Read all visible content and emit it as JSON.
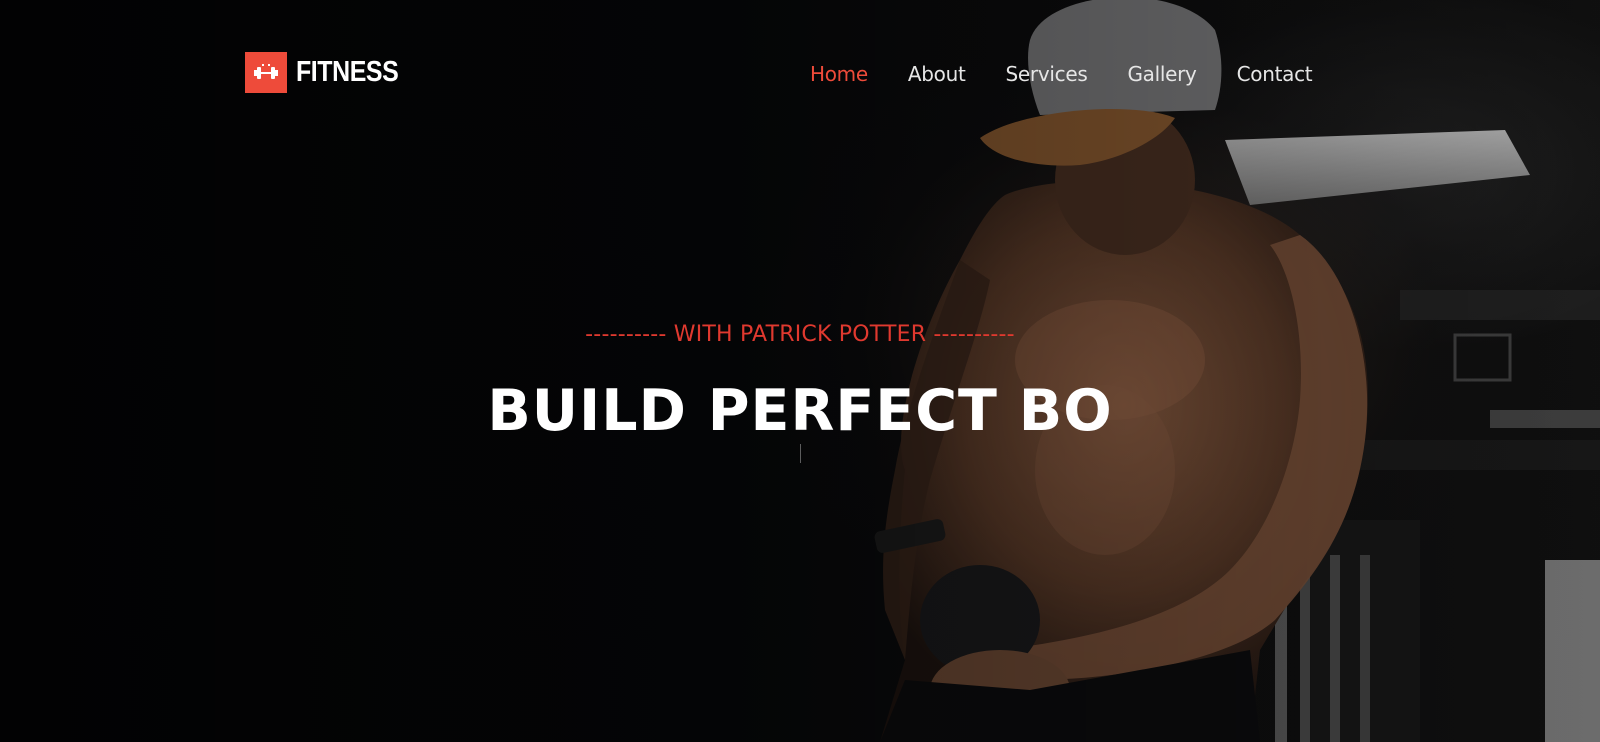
{
  "brand": {
    "name": "FITNESS",
    "icon": "dumbbell-icon",
    "accent_color": "#ee4b3a"
  },
  "nav": {
    "items": [
      {
        "label": "Home",
        "active": true
      },
      {
        "label": "About",
        "active": false
      },
      {
        "label": "Services",
        "active": false
      },
      {
        "label": "Gallery",
        "active": false
      },
      {
        "label": "Contact",
        "active": false
      }
    ]
  },
  "hero": {
    "subtitle": "---------- WITH PATRICK POTTER ----------",
    "headline": "BUILD PERFECT BO"
  }
}
